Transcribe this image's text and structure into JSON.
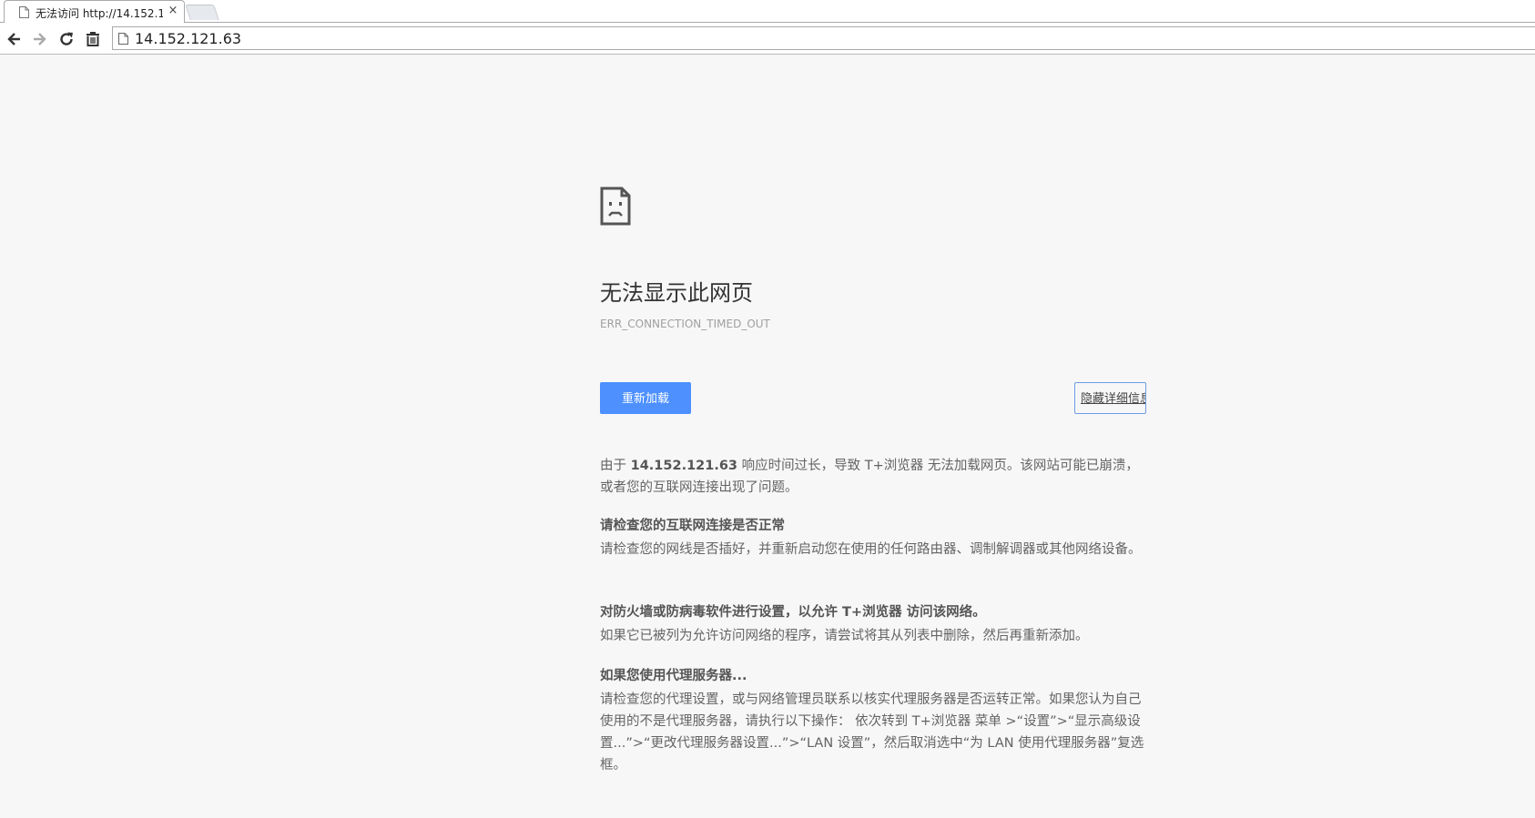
{
  "tab": {
    "title": "无法访问 http://14.152.1",
    "close_glyph": "×"
  },
  "omnibox": {
    "url": "14.152.121.63"
  },
  "error": {
    "heading": "无法显示此网页",
    "code": "ERR_CONNECTION_TIMED_OUT",
    "reload_label": "重新加载",
    "details_label": "隐藏详细信息",
    "summary_prefix": "由于 ",
    "summary_host": "14.152.121.63",
    "summary_suffix": " 响应时间过长，导致 T+浏览器 无法加载网页。该网站可能已崩溃，或者您的互联网连接出现了问题。",
    "sections": [
      {
        "title": "请检查您的互联网连接是否正常",
        "body": "请检查您的网线是否插好，并重新启动您在使用的任何路由器、调制解调器或其他网络设备。"
      },
      {
        "title": "对防火墙或防病毒软件进行设置，以允许 T+浏览器 访问该网络。",
        "body": "如果它已被列为允许访问网络的程序，请尝试将其从列表中删除，然后再重新添加。"
      },
      {
        "title": "如果您使用代理服务器...",
        "body": "请检查您的代理设置，或与网络管理员联系以核实代理服务器是否运转正常。如果您认为自己使用的不是代理服务器，请执行以下操作： 依次转到 T+浏览器 菜单 >“设置”>“显示高级设置...”>“更改代理服务器设置...”>“LAN 设置”，然后取消选中“为 LAN 使用代理服务器”复选框。"
      }
    ]
  },
  "icons": {
    "tab_favicon": "page-icon",
    "back": "back-arrow-icon",
    "forward": "forward-arrow-icon",
    "reload": "reload-icon",
    "clear": "trash-icon",
    "sad_page": "sad-page-icon"
  },
  "colors": {
    "accent": "#4d90fe",
    "background": "#f7f7f7"
  }
}
